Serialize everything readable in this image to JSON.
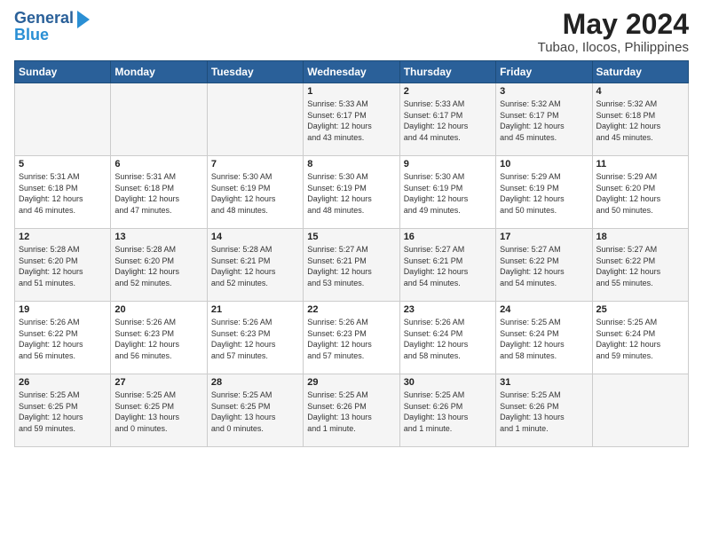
{
  "header": {
    "logo_line1": "General",
    "logo_line2": "Blue",
    "title": "May 2024",
    "subtitle": "Tubao, Ilocos, Philippines"
  },
  "days_of_week": [
    "Sunday",
    "Monday",
    "Tuesday",
    "Wednesday",
    "Thursday",
    "Friday",
    "Saturday"
  ],
  "weeks": [
    [
      {
        "num": "",
        "info": ""
      },
      {
        "num": "",
        "info": ""
      },
      {
        "num": "",
        "info": ""
      },
      {
        "num": "1",
        "info": "Sunrise: 5:33 AM\nSunset: 6:17 PM\nDaylight: 12 hours\nand 43 minutes."
      },
      {
        "num": "2",
        "info": "Sunrise: 5:33 AM\nSunset: 6:17 PM\nDaylight: 12 hours\nand 44 minutes."
      },
      {
        "num": "3",
        "info": "Sunrise: 5:32 AM\nSunset: 6:17 PM\nDaylight: 12 hours\nand 45 minutes."
      },
      {
        "num": "4",
        "info": "Sunrise: 5:32 AM\nSunset: 6:18 PM\nDaylight: 12 hours\nand 45 minutes."
      }
    ],
    [
      {
        "num": "5",
        "info": "Sunrise: 5:31 AM\nSunset: 6:18 PM\nDaylight: 12 hours\nand 46 minutes."
      },
      {
        "num": "6",
        "info": "Sunrise: 5:31 AM\nSunset: 6:18 PM\nDaylight: 12 hours\nand 47 minutes."
      },
      {
        "num": "7",
        "info": "Sunrise: 5:30 AM\nSunset: 6:19 PM\nDaylight: 12 hours\nand 48 minutes."
      },
      {
        "num": "8",
        "info": "Sunrise: 5:30 AM\nSunset: 6:19 PM\nDaylight: 12 hours\nand 48 minutes."
      },
      {
        "num": "9",
        "info": "Sunrise: 5:30 AM\nSunset: 6:19 PM\nDaylight: 12 hours\nand 49 minutes."
      },
      {
        "num": "10",
        "info": "Sunrise: 5:29 AM\nSunset: 6:19 PM\nDaylight: 12 hours\nand 50 minutes."
      },
      {
        "num": "11",
        "info": "Sunrise: 5:29 AM\nSunset: 6:20 PM\nDaylight: 12 hours\nand 50 minutes."
      }
    ],
    [
      {
        "num": "12",
        "info": "Sunrise: 5:28 AM\nSunset: 6:20 PM\nDaylight: 12 hours\nand 51 minutes."
      },
      {
        "num": "13",
        "info": "Sunrise: 5:28 AM\nSunset: 6:20 PM\nDaylight: 12 hours\nand 52 minutes."
      },
      {
        "num": "14",
        "info": "Sunrise: 5:28 AM\nSunset: 6:21 PM\nDaylight: 12 hours\nand 52 minutes."
      },
      {
        "num": "15",
        "info": "Sunrise: 5:27 AM\nSunset: 6:21 PM\nDaylight: 12 hours\nand 53 minutes."
      },
      {
        "num": "16",
        "info": "Sunrise: 5:27 AM\nSunset: 6:21 PM\nDaylight: 12 hours\nand 54 minutes."
      },
      {
        "num": "17",
        "info": "Sunrise: 5:27 AM\nSunset: 6:22 PM\nDaylight: 12 hours\nand 54 minutes."
      },
      {
        "num": "18",
        "info": "Sunrise: 5:27 AM\nSunset: 6:22 PM\nDaylight: 12 hours\nand 55 minutes."
      }
    ],
    [
      {
        "num": "19",
        "info": "Sunrise: 5:26 AM\nSunset: 6:22 PM\nDaylight: 12 hours\nand 56 minutes."
      },
      {
        "num": "20",
        "info": "Sunrise: 5:26 AM\nSunset: 6:23 PM\nDaylight: 12 hours\nand 56 minutes."
      },
      {
        "num": "21",
        "info": "Sunrise: 5:26 AM\nSunset: 6:23 PM\nDaylight: 12 hours\nand 57 minutes."
      },
      {
        "num": "22",
        "info": "Sunrise: 5:26 AM\nSunset: 6:23 PM\nDaylight: 12 hours\nand 57 minutes."
      },
      {
        "num": "23",
        "info": "Sunrise: 5:26 AM\nSunset: 6:24 PM\nDaylight: 12 hours\nand 58 minutes."
      },
      {
        "num": "24",
        "info": "Sunrise: 5:25 AM\nSunset: 6:24 PM\nDaylight: 12 hours\nand 58 minutes."
      },
      {
        "num": "25",
        "info": "Sunrise: 5:25 AM\nSunset: 6:24 PM\nDaylight: 12 hours\nand 59 minutes."
      }
    ],
    [
      {
        "num": "26",
        "info": "Sunrise: 5:25 AM\nSunset: 6:25 PM\nDaylight: 12 hours\nand 59 minutes."
      },
      {
        "num": "27",
        "info": "Sunrise: 5:25 AM\nSunset: 6:25 PM\nDaylight: 13 hours\nand 0 minutes."
      },
      {
        "num": "28",
        "info": "Sunrise: 5:25 AM\nSunset: 6:25 PM\nDaylight: 13 hours\nand 0 minutes."
      },
      {
        "num": "29",
        "info": "Sunrise: 5:25 AM\nSunset: 6:26 PM\nDaylight: 13 hours\nand 1 minute."
      },
      {
        "num": "30",
        "info": "Sunrise: 5:25 AM\nSunset: 6:26 PM\nDaylight: 13 hours\nand 1 minute."
      },
      {
        "num": "31",
        "info": "Sunrise: 5:25 AM\nSunset: 6:26 PM\nDaylight: 13 hours\nand 1 minute."
      },
      {
        "num": "",
        "info": ""
      }
    ]
  ]
}
